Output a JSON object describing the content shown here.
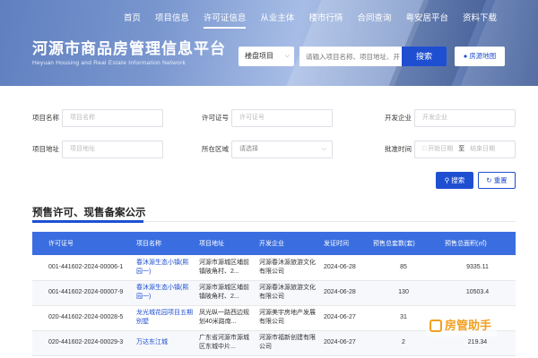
{
  "nav": [
    "首页",
    "项目信息",
    "许可证信息",
    "从业主体",
    "楼市行情",
    "合同查询",
    "粤安居平台",
    "资料下载"
  ],
  "nav_active": 2,
  "site": {
    "title": "河源市商品房管理信息平台",
    "subtitle": "Heyuan Housing and Real Estate Information Network"
  },
  "search": {
    "type": "楼盘项目",
    "placeholder": "请输入项目名称、项目地址、开",
    "button": "搜索",
    "map": "房源地图"
  },
  "filters": {
    "project_name": {
      "label": "项目名称",
      "placeholder": "项目名称"
    },
    "license_no": {
      "label": "许可证号",
      "placeholder": "许可证号"
    },
    "developer": {
      "label": "开发企业",
      "placeholder": "开发企业"
    },
    "address": {
      "label": "项目地址",
      "placeholder": "项目地址"
    },
    "region": {
      "label": "所在区域",
      "placeholder": "请选择"
    },
    "approval": {
      "label": "批准时间",
      "start": "开始日期",
      "sep": "至",
      "end": "结束日期"
    }
  },
  "buttons": {
    "query": "搜索",
    "reset": "重置"
  },
  "section_title": "预售许可、现售备案公示",
  "table": {
    "headers": [
      "许可证号",
      "项目名称",
      "项目地址",
      "开发企业",
      "发证时间",
      "预售总套数(套)",
      "预售总面积(㎡)"
    ],
    "rows": [
      [
        "001-441602-2024-00006-1",
        "春沐源生态小镇(熙园一)",
        "河源市源城区埔前镇陂角村、2...",
        "河源春沐源旅游文化有限公司",
        "2024-06-28",
        "85",
        "9335.11"
      ],
      [
        "001-441602-2024-00007-9",
        "春沐源生态小镇(熙园一)",
        "河源市源城区埔前镇陂角村、2...",
        "河源春沐源旅游文化有限公司",
        "2024-06-28",
        "130",
        "10503.4"
      ],
      [
        "020-441602-2024-00028-5",
        "龙光城花园项目五期别墅",
        "凤光纵一路西边规划40米路南...",
        "河源美宇房地产发展有限公司",
        "2024-06-27",
        "31",
        ""
      ],
      [
        "020-441602-2024-00029-3",
        "万达东江城",
        "广东省河源市源城区东城中片...",
        "河源市福新创建有限公司",
        "2024-06-27",
        "2",
        "219.34"
      ]
    ]
  },
  "watermark": "房管助手",
  "colors": {
    "primary": "#1f4fd1",
    "table_header": "#3a6ee0"
  },
  "icons": [
    "chevron-down-icon",
    "map-pin-icon",
    "search-icon",
    "refresh-icon"
  ]
}
